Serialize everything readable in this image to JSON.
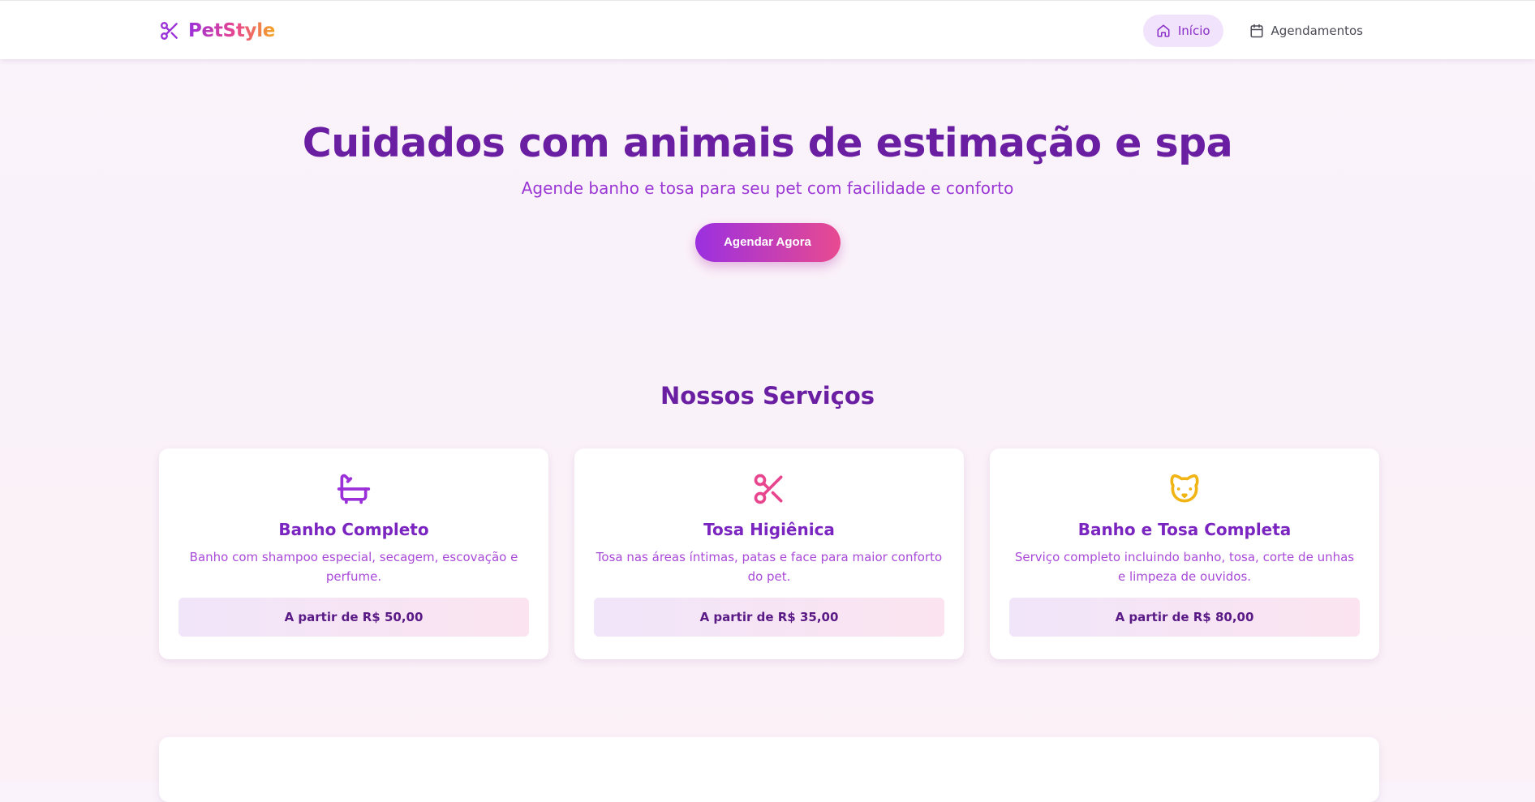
{
  "header": {
    "brand": "PetStyle",
    "brand_icon": "scissors-icon",
    "nav": [
      {
        "label": "Início",
        "icon": "home-icon",
        "active": true
      },
      {
        "label": "Agendamentos",
        "icon": "calendar-icon",
        "active": false
      }
    ]
  },
  "hero": {
    "title": "Cuidados com animais de estimação e spa",
    "subtitle": "Agende banho e tosa para seu pet com facilidade e conforto",
    "cta_label": "Agendar Agora"
  },
  "services": {
    "title": "Nossos Serviços",
    "items": [
      {
        "title": "Banho Completo",
        "description": "Banho com shampoo especial, secagem, escovação e perfume.",
        "price": "A partir de R$ 50,00",
        "icon": "bathtub-icon",
        "icon_color": "#9b30d9"
      },
      {
        "title": "Tosa Higiênica",
        "description": "Tosa nas áreas íntimas, patas e face para maior conforto do pet.",
        "price": "A partir de R$ 35,00",
        "icon": "scissors-icon",
        "icon_color": "#e8458f"
      },
      {
        "title": "Banho e Tosa Completa",
        "description": "Serviço completo incluindo banho, tosa, corte de unhas e limpeza de ouvidos.",
        "price": "A partir de R$ 80,00",
        "icon": "dog-icon",
        "icon_color": "#f0b414"
      }
    ]
  },
  "colors": {
    "primary": "#6a1fa3",
    "accent_purple": "#9b30d9",
    "accent_pink": "#e8458f",
    "accent_yellow": "#f0b414"
  }
}
